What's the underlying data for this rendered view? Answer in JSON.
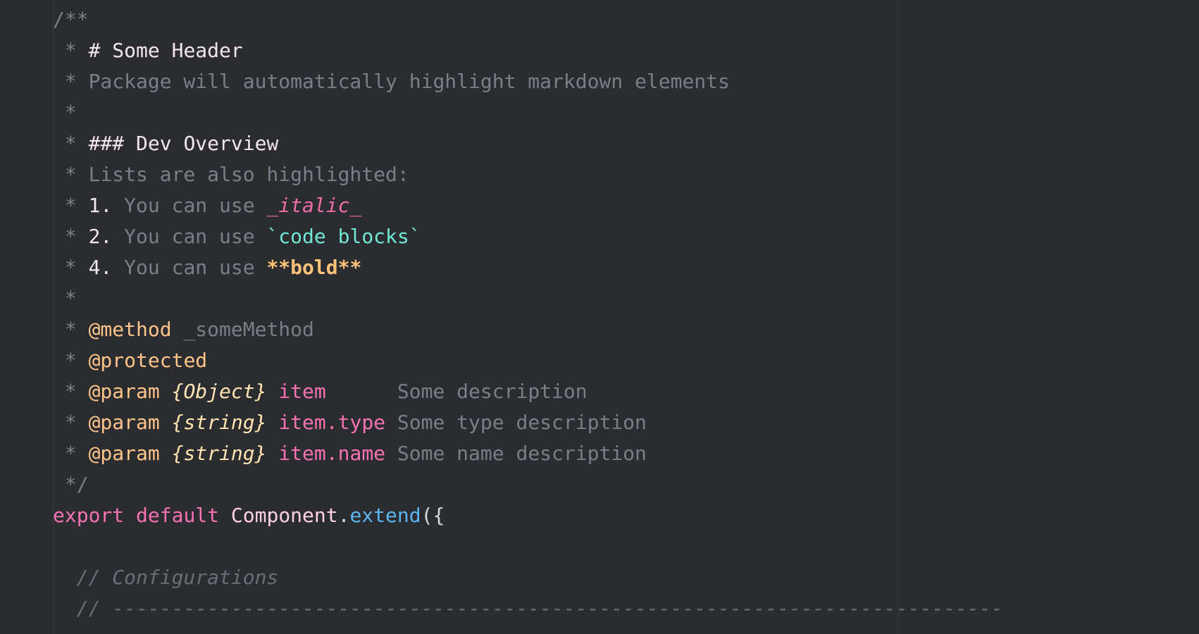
{
  "editor": {
    "lines": [
      [
        {
          "t": "/**",
          "c": "comment"
        }
      ],
      [
        {
          "t": " * ",
          "c": "comment"
        },
        {
          "t": "# Some Header",
          "c": "head"
        }
      ],
      [
        {
          "t": " * Package will automatically highlight markdown elements",
          "c": "comment"
        }
      ],
      [
        {
          "t": " *",
          "c": "comment"
        }
      ],
      [
        {
          "t": " * ",
          "c": "comment"
        },
        {
          "t": "### Dev Overview",
          "c": "head"
        }
      ],
      [
        {
          "t": " * Lists are also highlighted:",
          "c": "comment"
        }
      ],
      [
        {
          "t": " * ",
          "c": "comment"
        },
        {
          "t": "1.",
          "c": "num"
        },
        {
          "t": " You can use ",
          "c": "comment"
        },
        {
          "t": "_italic_",
          "c": "italic"
        }
      ],
      [
        {
          "t": " * ",
          "c": "comment"
        },
        {
          "t": "2.",
          "c": "num"
        },
        {
          "t": " You can use ",
          "c": "comment"
        },
        {
          "t": "`code blocks`",
          "c": "code"
        }
      ],
      [
        {
          "t": " * ",
          "c": "comment"
        },
        {
          "t": "4.",
          "c": "num"
        },
        {
          "t": " You can use ",
          "c": "comment"
        },
        {
          "t": "**bold**",
          "c": "bold"
        }
      ],
      [
        {
          "t": " *",
          "c": "comment"
        }
      ],
      [
        {
          "t": " * ",
          "c": "comment"
        },
        {
          "t": "@method",
          "c": "tag"
        },
        {
          "t": " _someMethod",
          "c": "comment"
        }
      ],
      [
        {
          "t": " * ",
          "c": "comment"
        },
        {
          "t": "@protected",
          "c": "tag"
        }
      ],
      [
        {
          "t": " * ",
          "c": "comment"
        },
        {
          "t": "@param",
          "c": "tag"
        },
        {
          "t": " ",
          "c": "comment"
        },
        {
          "t": "{Object}",
          "c": "type"
        },
        {
          "t": " ",
          "c": "comment"
        },
        {
          "t": "item",
          "c": "pname"
        },
        {
          "t": "      Some description",
          "c": "desc"
        }
      ],
      [
        {
          "t": " * ",
          "c": "comment"
        },
        {
          "t": "@param",
          "c": "tag"
        },
        {
          "t": " ",
          "c": "comment"
        },
        {
          "t": "{string}",
          "c": "type"
        },
        {
          "t": " ",
          "c": "comment"
        },
        {
          "t": "item.type",
          "c": "pname"
        },
        {
          "t": " Some type description",
          "c": "desc"
        }
      ],
      [
        {
          "t": " * ",
          "c": "comment"
        },
        {
          "t": "@param",
          "c": "tag"
        },
        {
          "t": " ",
          "c": "comment"
        },
        {
          "t": "{string}",
          "c": "type"
        },
        {
          "t": " ",
          "c": "comment"
        },
        {
          "t": "item.name",
          "c": "pname"
        },
        {
          "t": " Some name description",
          "c": "desc"
        }
      ],
      [
        {
          "t": " */",
          "c": "comment"
        }
      ],
      [
        {
          "t": "export",
          "c": "keyword"
        },
        {
          "t": " ",
          "c": "punc"
        },
        {
          "t": "default",
          "c": "keyword"
        },
        {
          "t": " ",
          "c": "punc"
        },
        {
          "t": "Component",
          "c": "cls"
        },
        {
          "t": ".",
          "c": "punc"
        },
        {
          "t": "extend",
          "c": "method"
        },
        {
          "t": "({",
          "c": "punc"
        }
      ],
      [
        {
          "t": "",
          "c": "punc"
        }
      ],
      [
        {
          "t": "  // Configurations",
          "c": "lcomment"
        }
      ],
      [
        {
          "t": "  // ---------------------------------------------------------------------------",
          "c": "lcomment"
        }
      ]
    ]
  },
  "colors": {
    "background": "#2b2c2f",
    "comment": "#7b7e87",
    "keyword": "#f573b3",
    "tag": "#ffc58a",
    "code": "#6fe8d6",
    "method": "#5cb6f2"
  }
}
